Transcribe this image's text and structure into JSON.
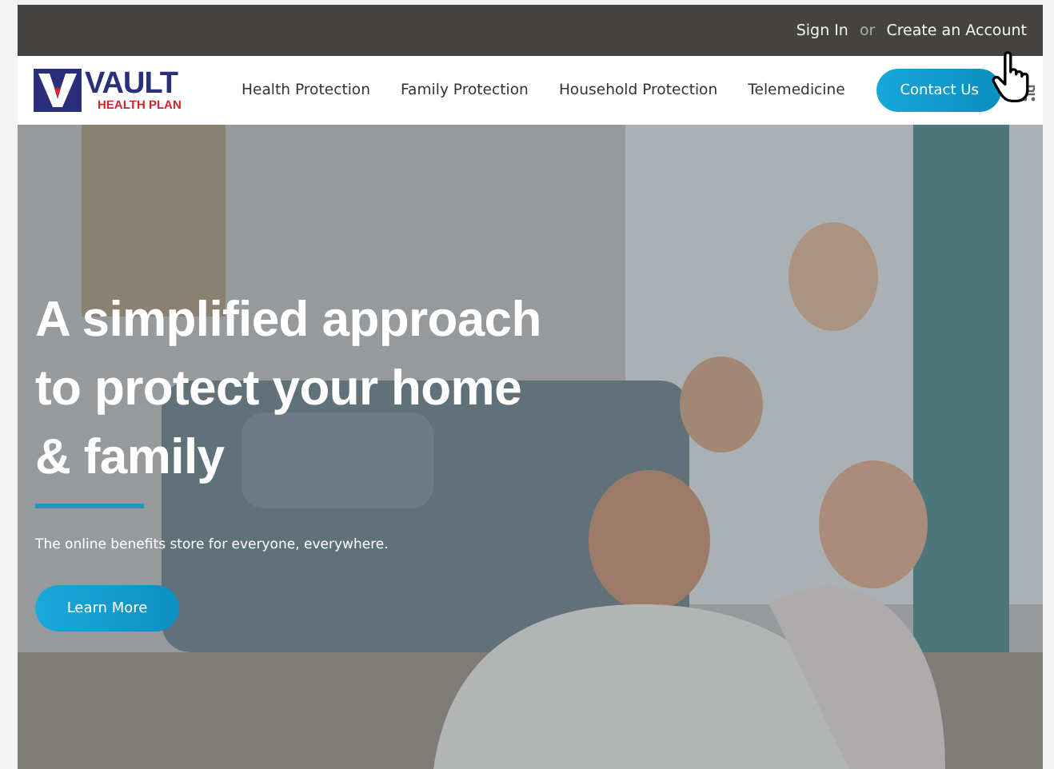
{
  "top_bar": {
    "sign_in": "Sign In",
    "separator": "or",
    "create_account": "Create an Account"
  },
  "logo": {
    "name": "VAULT",
    "tagline": "HEALTH PLAN"
  },
  "nav": {
    "items": [
      "Health Protection",
      "Family Protection",
      "Household Protection",
      "Telemedicine"
    ],
    "contact_button": "Contact Us"
  },
  "hero": {
    "headline_lines": [
      "A simplified approach",
      "to protect your home",
      "& family"
    ],
    "subtitle": "The online benefits store for everyone, everywhere.",
    "button": "Learn More"
  }
}
